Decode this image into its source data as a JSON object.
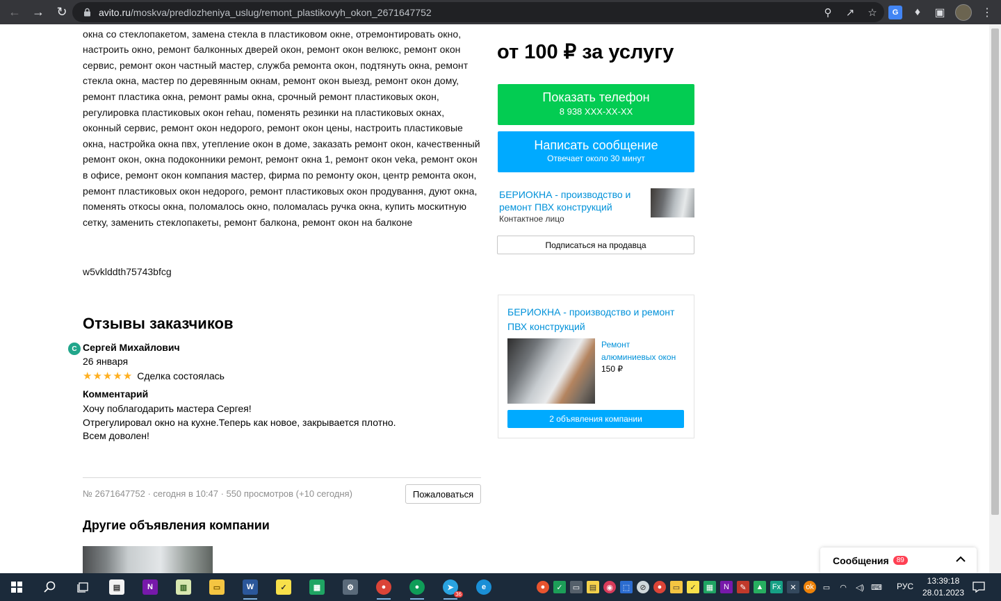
{
  "browser": {
    "url_host": "avito.ru",
    "url_path": "/moskva/predlozheniya_uslug/remont_plastikovyh_okon_2671647752"
  },
  "listing": {
    "description": "ремонт окон, специалист по ремонту окон, поставить откосы, утеплить откосы, ремонт окна со стеклопакетом, замена стекла в пластиковом окне, отремонтировать окно, настроить окно, ремонт балконных дверей окон, ремонт окон велюкс, ремонт окон сервис, ремонт окон частный мастер, служба ремонта окон, подтянуть окна, ремонт стекла окна, мастер по деревянным окнам, ремонт окон выезд, ремонт окон дому, ремонт пластика окна, ремонт рамы окна, срочный ремонт пластиковых окон, регулировка пластиковых окон rehau, поменять резинки на пластиковых окнах, оконный сервис, ремонт окон недорого, ремонт окон цены, настроить пластиковые окна, настройка окна пвх, утепление окон в доме, заказать ремонт окон, качественный ремонт окон, окна подоконники ремонт, ремонт окна 1, ремонт окон veka, ремонт окон в офисе, ремонт окон компания мастер, фирма по ремонту окон, центр ремонта окон, ремонт пластиковых окон недорого, ремонт пластиковых окон продування, дуют окна, поменять откосы окна, поломалось окно, поломалась ручка окна, купить москитную сетку, заменить стеклопакеты, ремонт балкона, ремонт окон на балконе",
    "code": "w5vklddth75743bfcg",
    "meta": "№ 2671647752 · сегодня в 10:47 · 550 просмотров (+10 сегодня)",
    "complain_label": "Пожаловаться",
    "other_title": "Другие объявления компании"
  },
  "reviews": {
    "title": "Отзывы заказчиков",
    "avatar_letter": "С",
    "author": "Сергей Михайлович",
    "date": "26 января",
    "stars": "★★★★★",
    "rating": 5,
    "deal_status": "Сделка состоялась",
    "comment_label": "Комментарий",
    "comment_lines": [
      "Хочу поблагодарить мастера Сергея!",
      "Отрегулировал окно на кухне.Теперь как новое, закрывается плотно.",
      "Всем доволен!"
    ]
  },
  "sidebar": {
    "price": "от 100 ₽ за услугу",
    "phone_button": "Показать телефон",
    "phone_masked": "8 938 XXX-XX-XX",
    "message_button": "Написать сообщение",
    "message_sub": "Отвечает около 30 минут",
    "seller_name": "БЕРИОКНА - производство и ремонт ПВХ конструкций",
    "seller_role": "Контактное лицо",
    "subscribe_label": "Подписаться на продавца",
    "company_card": {
      "name": "БЕРИОКНА - производство и ремонт ПВХ конструкций",
      "ad_title": "Ремонт алюминиевых окон",
      "ad_price": "150 ₽",
      "ads_button": "2 объявления компании"
    }
  },
  "messages": {
    "label": "Сообщения",
    "count": "89"
  },
  "taskbar": {
    "lang": "РУС",
    "time": "13:39:18",
    "date": "28.01.2023",
    "telegram_badge": "36"
  },
  "colors": {
    "green": "#03cc52",
    "blue": "#00aaff",
    "link": "#0091d9",
    "star": "#ffb021",
    "badge": "#ff4053"
  }
}
